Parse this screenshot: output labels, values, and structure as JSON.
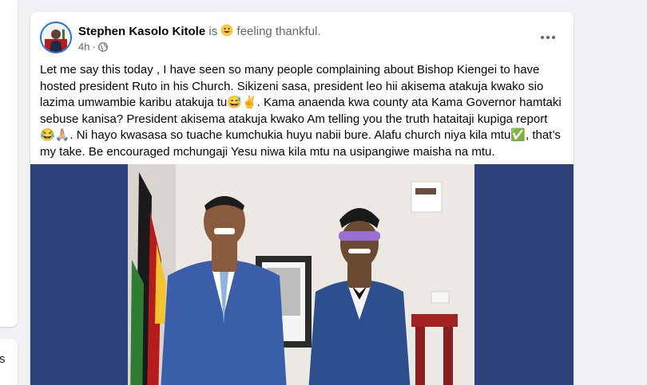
{
  "sidebar_fragment": {
    "text": "s"
  },
  "post": {
    "author": "Stephen Kasolo Kitole",
    "is_text": "is",
    "feeling": "feeling thankful.",
    "time": "4h",
    "visibility_icon": "globe-icon",
    "more_icon": "more-horizontal-icon",
    "paragraph": "Let me say this today , I have seen so many people complaining about Bishop Kiengei to have hosted president Ruto in his Church. Sikizeni sasa, president leo hii akisema atakuja kwako sio lazima umwambie karibu atakuja tu😅✌️. Kama anaenda kwa county ata Kama Governor hamtaki sebuse kanisa? President akisema atakuja kwako Am telling you the truth hataitaji kupiga report 😂🙏🏼. Ni hayo kwasasa so tuache kumchukia huyu nabii bure. Alafu church niya kila mtu✅, that’s my take. Be encouraged mchungaji Yesu niwa kila mtu na usipangiwe maisha na mtu."
  },
  "colors": {
    "accent": "#1b74e4",
    "photo_background": "#2e417a",
    "page_background": "#f0f2f5"
  }
}
